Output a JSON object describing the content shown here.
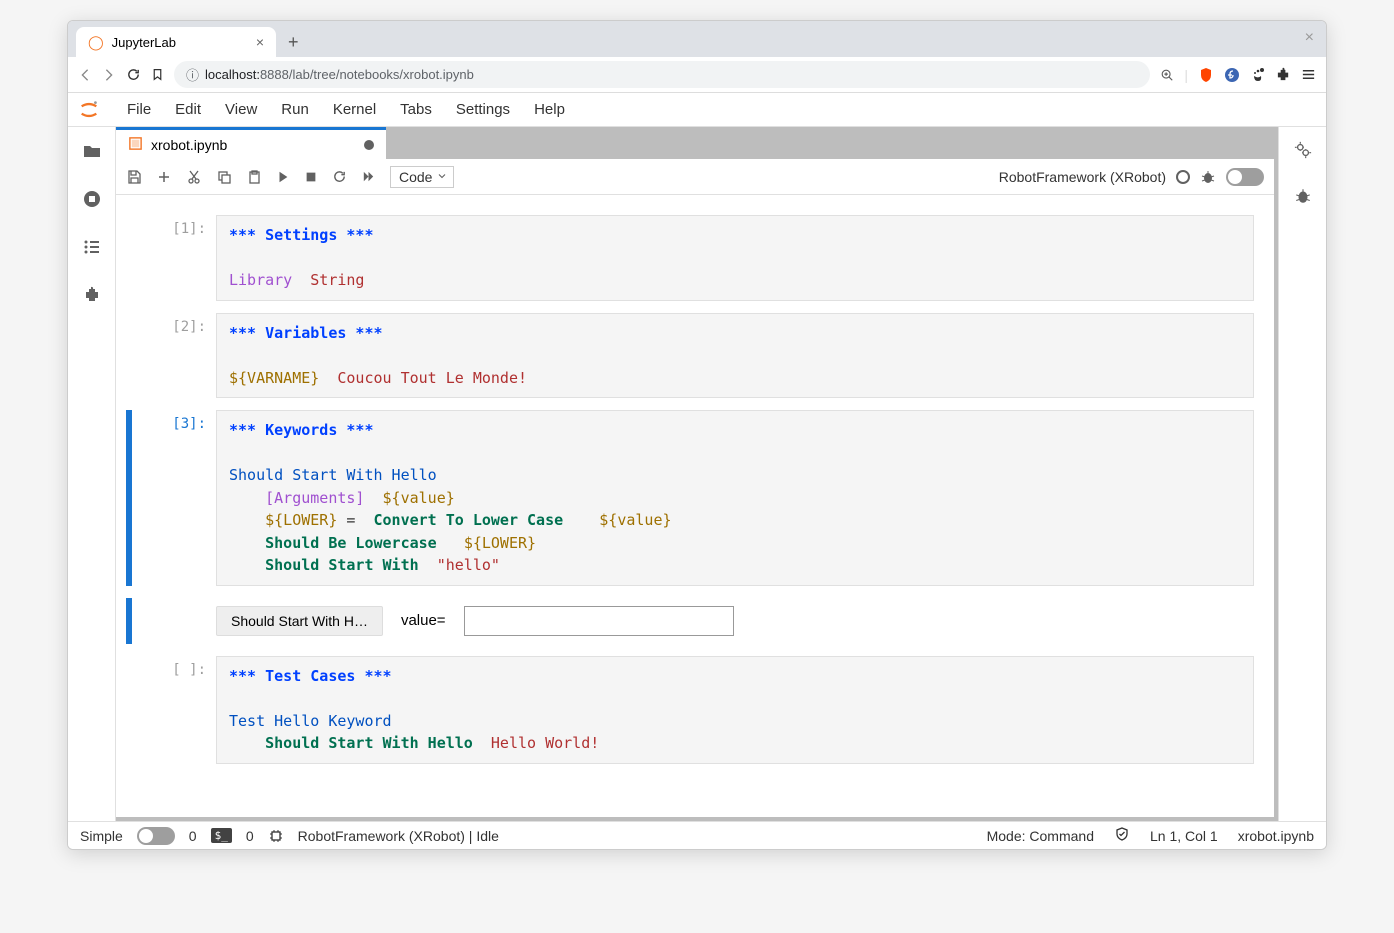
{
  "browser": {
    "tab_title": "JupyterLab",
    "url_prefix": "localhost:",
    "url_path": "8888/lab/tree/notebooks/xrobot.ipynb"
  },
  "menu": {
    "items": [
      "File",
      "Edit",
      "View",
      "Run",
      "Kernel",
      "Tabs",
      "Settings",
      "Help"
    ]
  },
  "doc_tab": {
    "label": "xrobot.ipynb"
  },
  "toolbar": {
    "cell_type": "Code",
    "kernel_name": "RobotFramework (XRobot)"
  },
  "cells": [
    {
      "prompt": "[1]:",
      "active": false,
      "code": [
        {
          "cls": "tok-header",
          "t": "*** Settings ***"
        },
        {
          "t": "\n\n"
        },
        {
          "cls": "tok-lib",
          "t": "Library"
        },
        {
          "t": "  "
        },
        {
          "cls": "tok-str",
          "t": "String"
        }
      ]
    },
    {
      "prompt": "[2]:",
      "active": false,
      "code": [
        {
          "cls": "tok-header",
          "t": "*** Variables ***"
        },
        {
          "t": "\n\n"
        },
        {
          "cls": "tok-var",
          "t": "${VARNAME}"
        },
        {
          "t": "  "
        },
        {
          "cls": "tok-str",
          "t": "Coucou Tout Le Monde!"
        }
      ]
    },
    {
      "prompt": "[3]:",
      "active": true,
      "code": [
        {
          "cls": "tok-header",
          "t": "*** Keywords ***"
        },
        {
          "t": "\n\n"
        },
        {
          "cls": "tok-blue",
          "t": "Should Start With Hello"
        },
        {
          "t": "\n    "
        },
        {
          "cls": "tok-args",
          "t": "[Arguments]"
        },
        {
          "t": "  "
        },
        {
          "cls": "tok-var",
          "t": "${value}"
        },
        {
          "t": "\n    "
        },
        {
          "cls": "tok-var",
          "t": "${LOWER}"
        },
        {
          "t": " =  "
        },
        {
          "cls": "tok-kw",
          "t": "Convert To Lower Case"
        },
        {
          "t": "    "
        },
        {
          "cls": "tok-var",
          "t": "${value}"
        },
        {
          "t": "\n    "
        },
        {
          "cls": "tok-kw",
          "t": "Should Be Lowercase"
        },
        {
          "t": "   "
        },
        {
          "cls": "tok-var",
          "t": "${LOWER}"
        },
        {
          "t": "\n    "
        },
        {
          "cls": "tok-kw",
          "t": "Should Start With"
        },
        {
          "t": "  "
        },
        {
          "cls": "tok-str",
          "t": "\"hello\""
        }
      ],
      "output": {
        "button": "Should Start With H…",
        "label": "value="
      }
    },
    {
      "prompt": "[ ]:",
      "active": false,
      "code": [
        {
          "cls": "tok-header",
          "t": "*** Test Cases ***"
        },
        {
          "t": "\n\n"
        },
        {
          "cls": "tok-blue",
          "t": "Test Hello Keyword"
        },
        {
          "t": "\n    "
        },
        {
          "cls": "tok-kw",
          "t": "Should Start With Hello"
        },
        {
          "t": "  "
        },
        {
          "cls": "tok-str",
          "t": "Hello World!"
        }
      ]
    }
  ],
  "status": {
    "simple": "Simple",
    "open0": "0",
    "open1": "0",
    "kernel": "RobotFramework (XRobot) | Idle",
    "mode": "Mode: Command",
    "cursor": "Ln 1, Col 1",
    "file": "xrobot.ipynb"
  }
}
